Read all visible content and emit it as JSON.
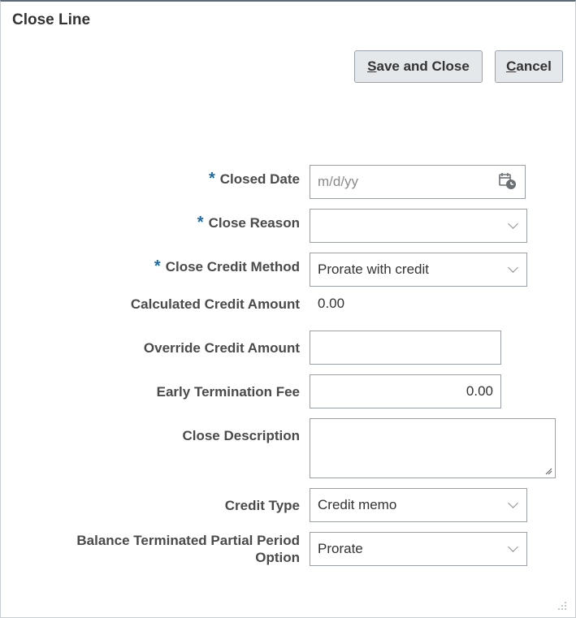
{
  "dialog": {
    "title": "Close Line",
    "buttons": {
      "save_prefix": "S",
      "save_rest": "ave and Close",
      "cancel_prefix": "C",
      "cancel_rest": "ancel"
    }
  },
  "form": {
    "closed_date": {
      "label": "Closed Date",
      "required": true,
      "placeholder": "m/d/yy",
      "value": ""
    },
    "close_reason": {
      "label": "Close Reason",
      "required": true,
      "value": ""
    },
    "close_credit_method": {
      "label": "Close Credit Method",
      "required": true,
      "value": "Prorate with credit"
    },
    "calculated_credit_amount": {
      "label": "Calculated Credit Amount",
      "value": "0.00"
    },
    "override_credit_amount": {
      "label": "Override Credit Amount",
      "value": ""
    },
    "early_termination_fee": {
      "label": "Early Termination Fee",
      "value": "0.00"
    },
    "close_description": {
      "label": "Close Description",
      "value": ""
    },
    "credit_type": {
      "label": "Credit Type",
      "value": "Credit memo"
    },
    "balance_terminated_option": {
      "label_line1": "Balance Terminated Partial Period",
      "label_line2": "Option",
      "value": "Prorate"
    }
  },
  "required_marker": "*",
  "icons": [
    "calendar-icon",
    "chevron-down-icon",
    "resize-handle-icon",
    "dialog-grip-icon"
  ],
  "colors": {
    "required": "#1a6ba5",
    "button_bg": "#e4e8eb",
    "border": "#9aa0a6"
  }
}
